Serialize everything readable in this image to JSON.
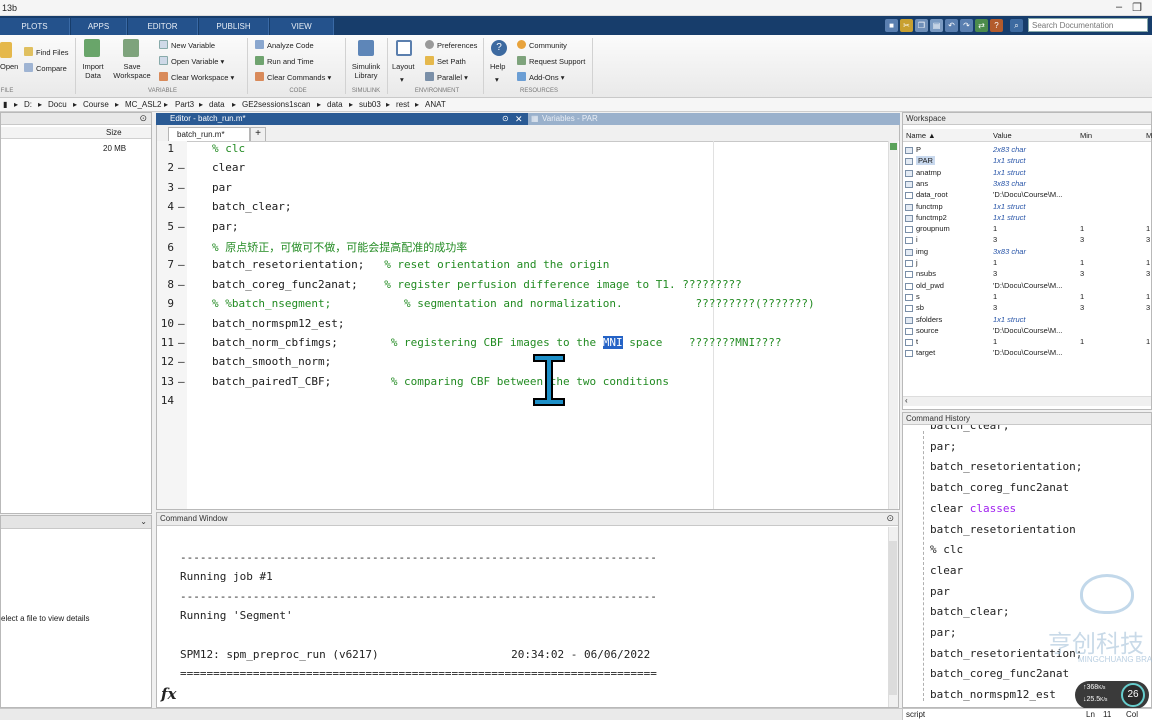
{
  "window": {
    "title": "13b"
  },
  "tabs": [
    "PLOTS",
    "APPS",
    "EDITOR",
    "PUBLISH",
    "VIEW"
  ],
  "search": {
    "placeholder": "Search Documentation"
  },
  "ribbon": {
    "file": {
      "open": "Open",
      "find_files": "Find Files",
      "compare": "Compare",
      "section": "FILE"
    },
    "variable": {
      "import_data": [
        "Import",
        "Data"
      ],
      "save_workspace": [
        "Save",
        "Workspace"
      ],
      "new_variable": "New Variable",
      "open_variable": "Open Variable",
      "clear_workspace": "Clear Workspace",
      "section": "VARIABLE"
    },
    "code": {
      "analyze": "Analyze Code",
      "run_time": "Run and Time",
      "clear_commands": "Clear Commands",
      "section": "CODE"
    },
    "simulink": {
      "label": [
        "Simulink",
        "Library"
      ],
      "section": "SIMULINK"
    },
    "environment": {
      "layout": "Layout",
      "preferences": "Preferences",
      "set_path": "Set Path",
      "parallel": "Parallel",
      "section": "ENVIRONMENT"
    },
    "resources": {
      "help": "Help",
      "community": "Community",
      "request_support": "Request Support",
      "addons": "Add-Ons",
      "section": "RESOURCES"
    }
  },
  "address": [
    "D:",
    "Docu",
    "Course",
    "MC_ASL2",
    "Part3",
    "data",
    "GE2sessions1scan",
    "data",
    "sub03",
    "rest",
    "ANAT"
  ],
  "current_folder": {
    "size_header": "Size",
    "size_value": "20 MB",
    "detail_text": "elect a file to view details"
  },
  "editor": {
    "title": "Editor - batch_run.m*",
    "variables_title": "Variables - PAR",
    "file_tab": "batch_run.m*",
    "lines": [
      {
        "n": "1",
        "dash": "",
        "parts": [
          {
            "t": "% clc",
            "c": "cm"
          }
        ]
      },
      {
        "n": "2",
        "dash": "—",
        "parts": [
          {
            "t": "clear",
            "c": ""
          }
        ]
      },
      {
        "n": "3",
        "dash": "—",
        "parts": [
          {
            "t": "par",
            "c": ""
          }
        ]
      },
      {
        "n": "4",
        "dash": "—",
        "parts": [
          {
            "t": "batch_clear;",
            "c": ""
          }
        ]
      },
      {
        "n": "5",
        "dash": "—",
        "parts": [
          {
            "t": "par;",
            "c": ""
          }
        ]
      },
      {
        "n": "6",
        "dash": "",
        "parts": [
          {
            "t": "% 原点矫正，可做可不做，可能会提高配准的成功率",
            "c": "cm"
          }
        ]
      },
      {
        "n": "7",
        "dash": "—",
        "parts": [
          {
            "t": "batch_resetorientation;   ",
            "c": ""
          },
          {
            "t": "% reset orientation and the origin",
            "c": "cm"
          }
        ]
      },
      {
        "n": "8",
        "dash": "—",
        "parts": [
          {
            "t": "batch_coreg_func2anat;    ",
            "c": ""
          },
          {
            "t": "% register perfusion difference image to T1. ?????????",
            "c": "cm"
          }
        ]
      },
      {
        "n": "9",
        "dash": "",
        "parts": [
          {
            "t": "% %batch_nsegment;           % segmentation and normalization.           ?????????(???????)",
            "c": "cm"
          }
        ]
      },
      {
        "n": "10",
        "dash": "—",
        "parts": [
          {
            "t": "batch_normspm12_est;",
            "c": ""
          }
        ]
      },
      {
        "n": "11",
        "dash": "—",
        "parts": [
          {
            "t": "batch_norm_cbfimgs;        ",
            "c": ""
          },
          {
            "t": "% registering CBF images to the ",
            "c": "cm"
          },
          {
            "t": "MNI",
            "c": "sel"
          },
          {
            "t": " space    ???????MNI????",
            "c": "cm"
          }
        ]
      },
      {
        "n": "12",
        "dash": "—",
        "parts": [
          {
            "t": "batch_smooth_norm;",
            "c": ""
          }
        ]
      },
      {
        "n": "13",
        "dash": "—",
        "parts": [
          {
            "t": "batch_pairedT_CBF;         ",
            "c": ""
          },
          {
            "t": "% comparing CBF between the two conditions",
            "c": "cm"
          }
        ]
      },
      {
        "n": "14",
        "dash": "",
        "parts": [
          {
            "t": "",
            "c": ""
          }
        ]
      }
    ]
  },
  "command_window": {
    "title": "Command Window",
    "lines": [
      "------------------------------------------------------------------------",
      "Running job #1",
      "------------------------------------------------------------------------",
      "Running 'Segment'",
      "",
      "SPM12: spm_preproc_run (v6217)                    20:34:02 - 06/06/2022",
      "========================================================================"
    ],
    "prompt": "fx"
  },
  "workspace": {
    "title": "Workspace",
    "columns": [
      "Name ▲",
      "Value",
      "Min",
      "M"
    ],
    "rows": [
      {
        "name": "P",
        "value": "2x83 char",
        "min": "",
        "max": "",
        "italic": true
      },
      {
        "name": "PAR",
        "value": "1x1 struct",
        "min": "",
        "max": "",
        "italic": true,
        "selected": true
      },
      {
        "name": "anatmp",
        "value": "1x1 struct",
        "min": "",
        "max": "",
        "italic": true
      },
      {
        "name": "ans",
        "value": "3x83 char",
        "min": "",
        "max": "",
        "italic": true
      },
      {
        "name": "data_root",
        "value": "'D:\\Docu\\Course\\M...",
        "min": "",
        "max": "",
        "italic": false
      },
      {
        "name": "functmp",
        "value": "1x1 struct",
        "min": "",
        "max": "",
        "italic": true
      },
      {
        "name": "functmp2",
        "value": "1x1 struct",
        "min": "",
        "max": "",
        "italic": true
      },
      {
        "name": "groupnum",
        "value": "1",
        "min": "1",
        "max": "1",
        "italic": false
      },
      {
        "name": "i",
        "value": "3",
        "min": "3",
        "max": "3",
        "italic": false
      },
      {
        "name": "img",
        "value": "3x83 char",
        "min": "",
        "max": "",
        "italic": true
      },
      {
        "name": "j",
        "value": "1",
        "min": "1",
        "max": "1",
        "italic": false
      },
      {
        "name": "nsubs",
        "value": "3",
        "min": "3",
        "max": "3",
        "italic": false
      },
      {
        "name": "old_pwd",
        "value": "'D:\\Docu\\Course\\M...",
        "min": "",
        "max": "",
        "italic": false
      },
      {
        "name": "s",
        "value": "1",
        "min": "1",
        "max": "1",
        "italic": false
      },
      {
        "name": "sb",
        "value": "3",
        "min": "3",
        "max": "3",
        "italic": false
      },
      {
        "name": "sfolders",
        "value": "1x1 struct",
        "min": "",
        "max": "",
        "italic": true
      },
      {
        "name": "source",
        "value": "'D:\\Docu\\Course\\M...",
        "min": "",
        "max": "",
        "italic": false
      },
      {
        "name": "t",
        "value": "1",
        "min": "1",
        "max": "1",
        "italic": false
      },
      {
        "name": "target",
        "value": "'D:\\Docu\\Course\\M...",
        "min": "",
        "max": "",
        "italic": false
      }
    ]
  },
  "history": {
    "title": "Command History",
    "lines": [
      {
        "t": "batch_clear;",
        "c": ""
      },
      {
        "t": "par;",
        "c": ""
      },
      {
        "t": "batch_resetorientation;",
        "c": ""
      },
      {
        "t": "batch_coreg_func2anat",
        "c": ""
      },
      {
        "t": "clear classes",
        "c": "kwstr"
      },
      {
        "t": "batch_resetorientation",
        "c": ""
      },
      {
        "t": "% clc",
        "c": "cm"
      },
      {
        "t": "clear",
        "c": ""
      },
      {
        "t": "par",
        "c": ""
      },
      {
        "t": "batch_clear;",
        "c": ""
      },
      {
        "t": "par;",
        "c": ""
      },
      {
        "t": "batch_resetorientation;",
        "c": ""
      },
      {
        "t": "batch_coreg_func2anat",
        "c": ""
      },
      {
        "t": "batch_normspm12_est",
        "c": ""
      }
    ]
  },
  "watermark": {
    "cn": "亨创科技",
    "en": "MINGCHUANG BRA"
  },
  "net_widget": {
    "up": "368",
    "down": "25.5",
    "unit": "K/s",
    "pct": "26"
  },
  "status": {
    "mode": "script",
    "ln_label": "Ln",
    "ln": "11",
    "col_label": "Col"
  }
}
